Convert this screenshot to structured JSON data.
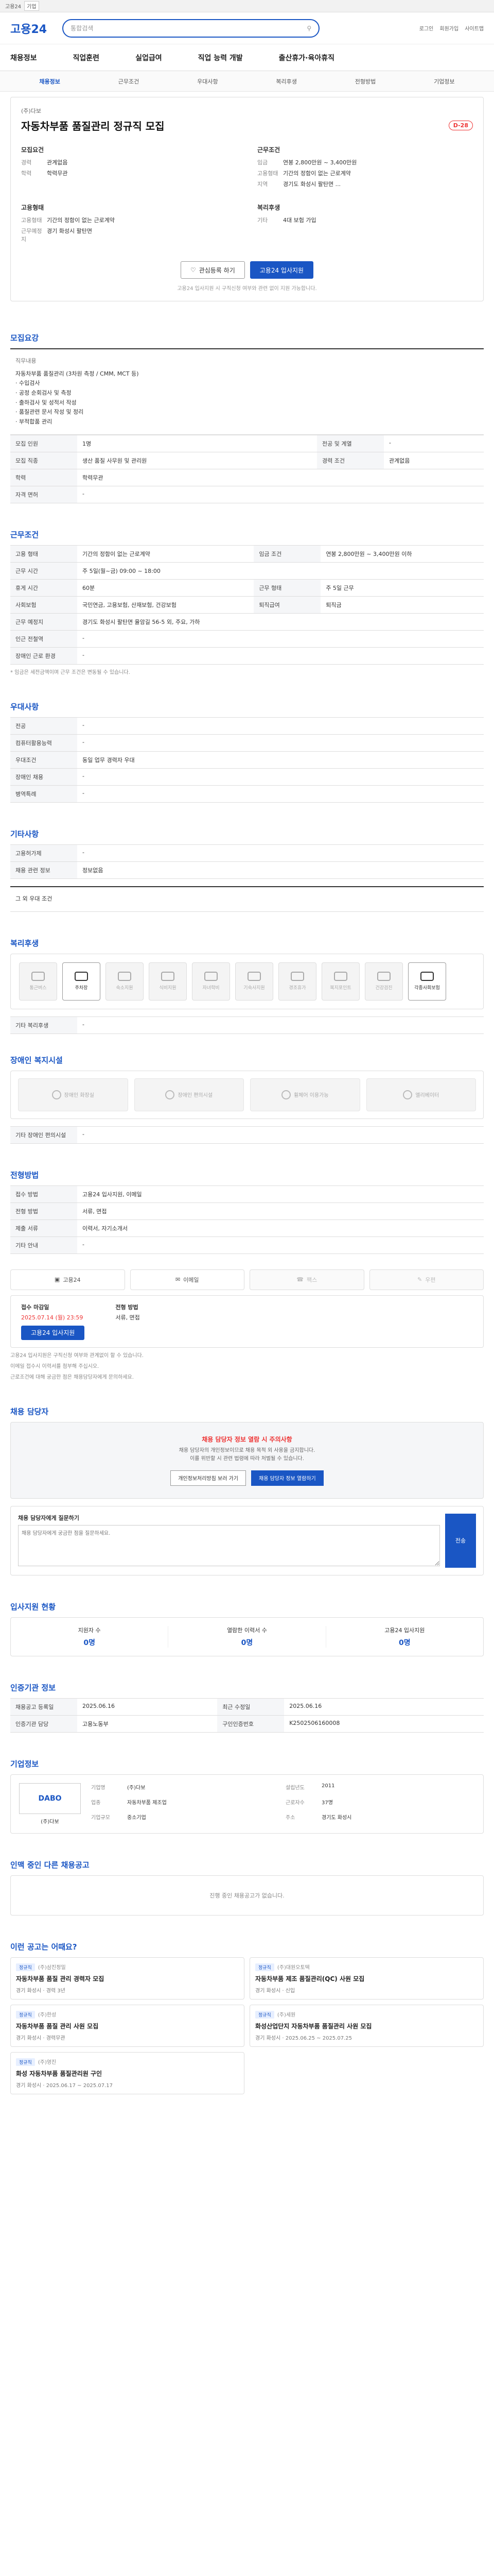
{
  "topbar": {
    "label": "고용24",
    "select": "기업"
  },
  "header": {
    "logo": "고용24",
    "search_placeholder": "통합검색",
    "util": [
      "로그인",
      "회원가입",
      "사이트맵"
    ]
  },
  "gnb": [
    "채용정보",
    "직업훈련",
    "실업급여",
    "직업 능력 개발",
    "출산휴가·육아휴직"
  ],
  "subnav": {
    "items": [
      "채용정보",
      "근무조건",
      "우대사항",
      "복리후생",
      "전형방법",
      "기업정보"
    ],
    "active": 0
  },
  "job": {
    "company": "(주)다보",
    "title": "자동차부품 품질관리 정규직 모집",
    "dday": "D-28",
    "left_title": "모집요건",
    "left": [
      {
        "k": "경력",
        "v": "관계없음"
      },
      {
        "k": "학력",
        "v": "학력무관"
      }
    ],
    "right_title": "근무조건",
    "right": [
      {
        "k": "임금",
        "v": "연봉 2,800만원 ~ 3,400만원"
      },
      {
        "k": "고용형태",
        "v": "기간의 정함이 없는 근로계약"
      },
      {
        "k": "지역",
        "v": "경기도 화성시 팔탄면 ..."
      }
    ],
    "left2_title": "고용형태",
    "left2": [
      {
        "k": "고용형태",
        "v": "기간의 정함이 없는 근로계약"
      },
      {
        "k": "근무예정지",
        "v": "경기 화성시 팔탄면"
      }
    ],
    "right2_title": "복리후생",
    "right2": [
      {
        "k": "기타",
        "v": "4대 보험 가입"
      }
    ],
    "btn_scrap": "관심등록 하기",
    "btn_apply": "고용24 입사지원",
    "note": "고용24 입사지원 시 구직신청 여부와 관련 없이 지원 가능합니다."
  },
  "recruit": {
    "title": "모집요강",
    "sub": "직무내용",
    "content": "자동차부품 품질관리 (3차원 측정 / CMM, MCT 등)\n· 수입검사\n· 공정 순회검사 및 측정\n· 출하검사 및 성적서 작성\n· 품질관련 문서 작성 및 정리\n· 부적합품 관리",
    "rows": [
      {
        "k": "모집 인원",
        "v": "1명",
        "k2": "전공 및 계열",
        "v2": "-"
      },
      {
        "k": "모집 직종",
        "v": "생산 품질 사무원 및 관리원",
        "k2": "경력 조건",
        "v2": "관계없음"
      },
      {
        "k": "학력",
        "v": "학력무관",
        "k2": "",
        "v2": ""
      },
      {
        "k": "자격 면허",
        "v": "-",
        "k2": "",
        "v2": ""
      }
    ]
  },
  "work": {
    "title": "근무조건",
    "rows": [
      {
        "k": "고용 형태",
        "v": "기간의 정함이 없는 근로계약",
        "k2": "임금 조건",
        "v2": "연봉 2,800만원 ~ 3,400만원 이하"
      },
      {
        "k": "근무 시간",
        "v": "주 5일(월~금) 09:00 ~ 18:00",
        "k2": "",
        "v2": ""
      },
      {
        "k": "휴게 시간",
        "v": "60분",
        "k2": "근무 형태",
        "v2": "주 5일 근무"
      },
      {
        "k": "사회보험",
        "v": "국민연금, 고용보험, 산재보험, 건강보험",
        "k2": "퇴직급여",
        "v2": "퇴직금"
      },
      {
        "k": "근무 예정지",
        "v": "경기도 화성시 팔탄면 율암길 56-5 외, 주요, 가하",
        "k2": "",
        "v2": ""
      },
      {
        "k": "인근 전철역",
        "v": "-",
        "k2": "",
        "v2": ""
      },
      {
        "k": "장애인 근로 환경",
        "v": "-",
        "k2": "",
        "v2": ""
      }
    ],
    "note": "* 임금은 세전금액이며 근무 조건은 변동될 수 있습니다."
  },
  "prefer": {
    "title": "우대사항",
    "rows": [
      {
        "k": "전공",
        "v": "-"
      },
      {
        "k": "컴퓨터활용능력",
        "v": "-"
      },
      {
        "k": "우대조건",
        "v": "동일 업무 경력자 우대"
      },
      {
        "k": "장애인 채용",
        "v": "-"
      },
      {
        "k": "병역특례",
        "v": "-"
      }
    ]
  },
  "other": {
    "title": "기타사항",
    "rows": [
      {
        "k": "고용허가제",
        "v": "-"
      },
      {
        "k": "채용 관련 정보",
        "v": "정보없음"
      }
    ],
    "sub": "그 외 우대 조건"
  },
  "welfare": {
    "title": "복리후생",
    "icons": [
      "통근버스",
      "주차장",
      "숙소지원",
      "식비지원",
      "자녀학비",
      "기숙사지원",
      "경조휴가",
      "복지포인트",
      "건강검진",
      "각종사회보험"
    ],
    "on": 1,
    "etc_label": "기타 복리후생",
    "etc_value": "-",
    "disabled_title": "장애인 복지시설",
    "disabled": [
      "장애인 화장실",
      "장애인 편의시설",
      "휠체어 이용가능",
      "엘리베이터"
    ],
    "disabled_etc": "기타 장애인 편의시설"
  },
  "process": {
    "title": "전형방법",
    "rows": [
      {
        "k": "접수 방법",
        "v": "고용24 입사지원, 이메일"
      },
      {
        "k": "전형 방법",
        "v": "서류, 면접"
      },
      {
        "k": "제출 서류",
        "v": "이력서, 자기소개서"
      },
      {
        "k": "기타 안내",
        "v": "-"
      }
    ],
    "apply": [
      "고용24",
      "이메일",
      "팩스",
      "우편"
    ],
    "period": {
      "lbl1": "접수 마감일",
      "v1": "2025.07.14 (월) 23:59",
      "lbl2": "전형 방법",
      "v2": "서류, 면접",
      "btn": "고용24 입사지원"
    },
    "notes": [
      "고용24 입사지원은 구직신청 여부와 관계없이 할 수 있습니다.",
      "이메일 접수시 이력서를 첨부해 주십시오.",
      "근로조건에 대해 궁금한 점은 채용담당자에게 문의하세요."
    ]
  },
  "manager": {
    "title": "채용 담당자",
    "warn": "채용 담당자 정보 열람 시 주의사항",
    "text": "채용 담당자의 개인정보이므로 채용 목적 외 사용을 금지합니다.\n이를 위반할 시 관련 법령에 따라 처벌될 수 있습니다.",
    "b1": "개인정보처리방침 보러 가기",
    "b2": "채용 담당자 정보 열람하기",
    "msg_title": "채용 담당자에게 질문하기",
    "msg_placeholder": "채용 담당자에게 궁금한 점을 질문하세요.",
    "send": "전송"
  },
  "stats": {
    "title": "입사지원 현황",
    "items": [
      {
        "k": "지원자 수",
        "v": "0명"
      },
      {
        "k": "열람한 이력서 수",
        "v": "0명"
      },
      {
        "k": "고용24 입사지원",
        "v": "0명"
      }
    ]
  },
  "info": {
    "title": "인증기관 정보",
    "rows": [
      {
        "k": "채용공고 등록일",
        "v": "2025.06.16",
        "k2": "최근 수정일",
        "v2": "2025.06.16"
      },
      {
        "k": "인증기관 담당",
        "v": "고용노동부",
        "k2": "구인인증번호",
        "v2": "K2502506160008"
      }
    ]
  },
  "company": {
    "title": "기업정보",
    "logo": "DABO",
    "name": "(주)다보",
    "rows": [
      {
        "k": "기업명",
        "v": "(주)다보",
        "k2": "설립년도",
        "v2": "2011"
      },
      {
        "k": "업종",
        "v": "자동차부품 제조업",
        "k2": "근로자수",
        "v2": "37명"
      },
      {
        "k": "기업규모",
        "v": "중소기업",
        "k2": "주소",
        "v2": "경기도 화성시"
      }
    ]
  },
  "also": {
    "title": "인맥 중인 다른 채용공고",
    "empty": "진행 중인 채용공고가 없습니다."
  },
  "similar": {
    "title": "이런 공고는 어때요?",
    "cards": [
      {
        "tag": "정규직",
        "company": "(주)삼진정밀",
        "title": "자동차부품 품질 관리 경력자 모집",
        "meta": "경기 화성시 · 경력 3년"
      },
      {
        "tag": "정규직",
        "company": "(주)대원오토텍",
        "title": "자동차부품 제조 품질관리(QC) 사원 모집",
        "meta": "경기 화성시 · 신입"
      },
      {
        "tag": "정규직",
        "company": "(주)한성",
        "title": "자동차부품 품질 관리 사원 모집",
        "meta": "경기 화성시 · 경력무관"
      },
      {
        "tag": "정규직",
        "company": "(주)세원",
        "title": "화성산업단지 자동차부품 품질관리 사원 모집",
        "meta": "경기 화성시 · 2025.06.25 ~ 2025.07.25"
      },
      {
        "tag": "정규직",
        "company": "(주)영진",
        "title": "화성 자동차부품 품질관리원 구인",
        "meta": "경기 화성시 · 2025.06.17 ~ 2025.07.17"
      }
    ]
  }
}
